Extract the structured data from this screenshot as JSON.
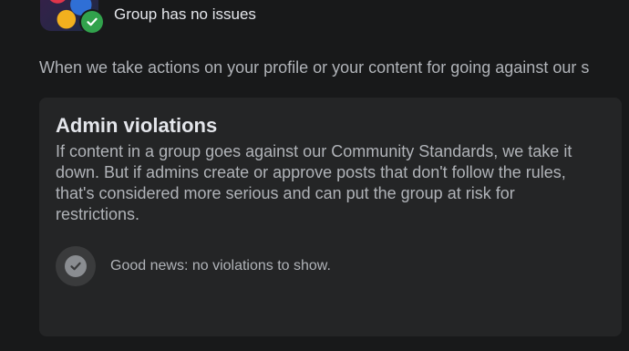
{
  "group": {
    "avatar_caption": "",
    "status_text": "Group has no issues",
    "status_icon": "check-circle-icon"
  },
  "intro": {
    "text": "When we take actions on your profile or your content for going against our s"
  },
  "admin_violations": {
    "title": "Admin violations",
    "description": "If content in a group goes against our Community Standards, we take it down. But if admins create or approve posts that don't follow the rules, that's considered more serious and can put the group at risk for restrictions.",
    "status_text": "Good news: no violations to show.",
    "status_icon": "check-circle-icon"
  },
  "colors": {
    "background": "#18191a",
    "card": "#242526",
    "success_green": "#31a24c",
    "neutral_check": "#8a8d91",
    "primary_text": "#e4e6eb",
    "secondary_text": "#b0b3b8"
  }
}
